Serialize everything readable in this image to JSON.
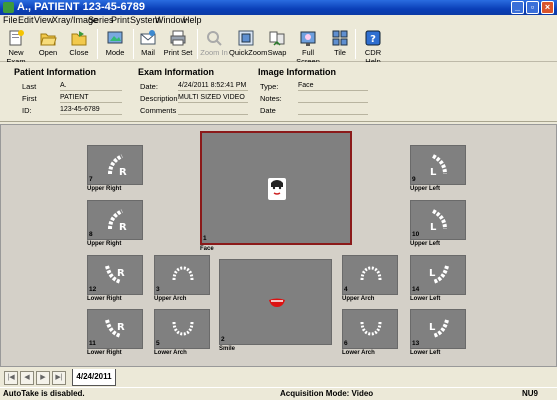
{
  "window": {
    "title": "A., PATIENT 123-45-6789",
    "controls": [
      "_",
      "▫",
      "×"
    ]
  },
  "menu": [
    "File",
    "Edit",
    "View",
    "Xray/Image",
    "Series",
    "Print",
    "System",
    "Window",
    "Help"
  ],
  "toolbar": {
    "new_exam": "New Exam",
    "open": "Open",
    "close": "Close",
    "mode": "Mode",
    "mail": "Mail",
    "print_set": "Print Set",
    "zoom_in": "Zoom In",
    "quickzoom": "QuickZoom",
    "swap": "Swap",
    "full_screen": "Full Screen",
    "tile": "Tile",
    "cdr_help": "CDR Help"
  },
  "patient": {
    "title": "Patient Information",
    "last_label": "Last",
    "last": "A.",
    "first_label": "First",
    "first": "PATIENT",
    "id_label": "ID:",
    "id": "123-45-6789"
  },
  "exam": {
    "title": "Exam Information",
    "date_label": "Date:",
    "date": "4/24/2011 8:52:41 PM",
    "description_label": "Description",
    "description": "MULTI SIZED VIDEO",
    "comments_label": "Comments",
    "comments": ""
  },
  "image": {
    "title": "Image Information",
    "type_label": "Type:",
    "type": "Face",
    "notes_label": "Notes:",
    "notes": "",
    "date_label": "Date",
    "date": ""
  },
  "thumbs": {
    "t7": {
      "num": "7",
      "caption": "Upper Right"
    },
    "t8": {
      "num": "8",
      "caption": "Upper Right"
    },
    "t12": {
      "num": "12",
      "caption": "Lower Right"
    },
    "t11": {
      "num": "11",
      "caption": "Lower Right"
    },
    "t3": {
      "num": "3",
      "caption": "Upper Arch"
    },
    "t5": {
      "num": "5",
      "caption": "Lower Arch"
    },
    "t1": {
      "num": "1",
      "caption": "Face"
    },
    "t2": {
      "num": "2",
      "caption": "Smile"
    },
    "t4": {
      "num": "4",
      "caption": "Upper Arch"
    },
    "t6": {
      "num": "6",
      "caption": "Lower Arch"
    },
    "t9": {
      "num": "9",
      "caption": "Upper Left"
    },
    "t10": {
      "num": "10",
      "caption": "Upper Left"
    },
    "t14": {
      "num": "14",
      "caption": "Lower Left"
    },
    "t13": {
      "num": "13",
      "caption": "Lower Left"
    }
  },
  "tab": {
    "date": "4/24/2011"
  },
  "status": {
    "left": "AutoTake is disabled.",
    "mode": "Acquisition Mode: Video",
    "flag": "NU9"
  },
  "colors": {
    "selected_border": "#8b1a1a",
    "thumb_bg": "#808080",
    "titlebar": "#0a3fb8"
  }
}
